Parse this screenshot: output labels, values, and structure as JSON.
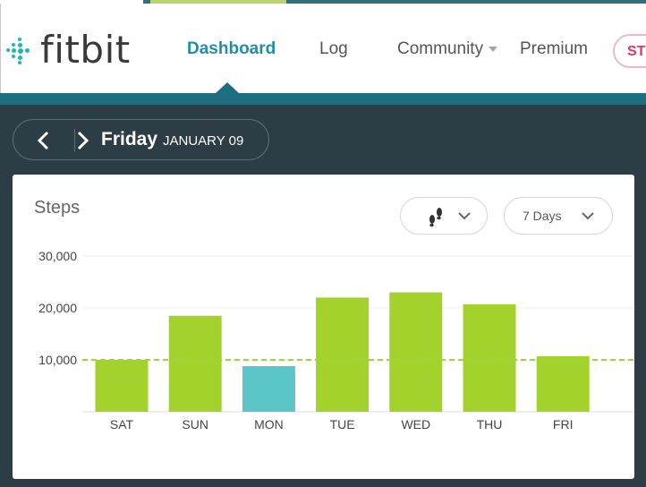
{
  "header": {
    "logo_text": "fitbit",
    "nav": [
      {
        "label": "Dashboard",
        "active": true
      },
      {
        "label": "Log",
        "active": false
      },
      {
        "label": "Community",
        "active": false,
        "dropdown": true
      },
      {
        "label": "Premium",
        "active": false
      }
    ],
    "cta_label": "ST"
  },
  "date_nav": {
    "day": "Friday",
    "date": "JANUARY 09"
  },
  "card": {
    "title": "Steps",
    "activity_icon": "footprints-icon",
    "range_label": "7 Days"
  },
  "colors": {
    "goal_met": "#a4d22d",
    "goal_not_met": "#5bc5c8",
    "goal_line": "#9ed63a",
    "accent": "#1f6d80"
  },
  "chart_data": {
    "type": "bar",
    "categories": [
      "SAT",
      "SUN",
      "MON",
      "TUE",
      "WED",
      "THU",
      "FRI"
    ],
    "values": [
      10000,
      18500,
      8800,
      22000,
      23000,
      20700,
      10700
    ],
    "goal": 10000,
    "yticks": [
      "30,000",
      "20,000",
      "10,000"
    ],
    "ytick_values": [
      30000,
      20000,
      10000
    ],
    "ylim": [
      0,
      30000
    ],
    "xlabel": "",
    "ylabel": ""
  }
}
